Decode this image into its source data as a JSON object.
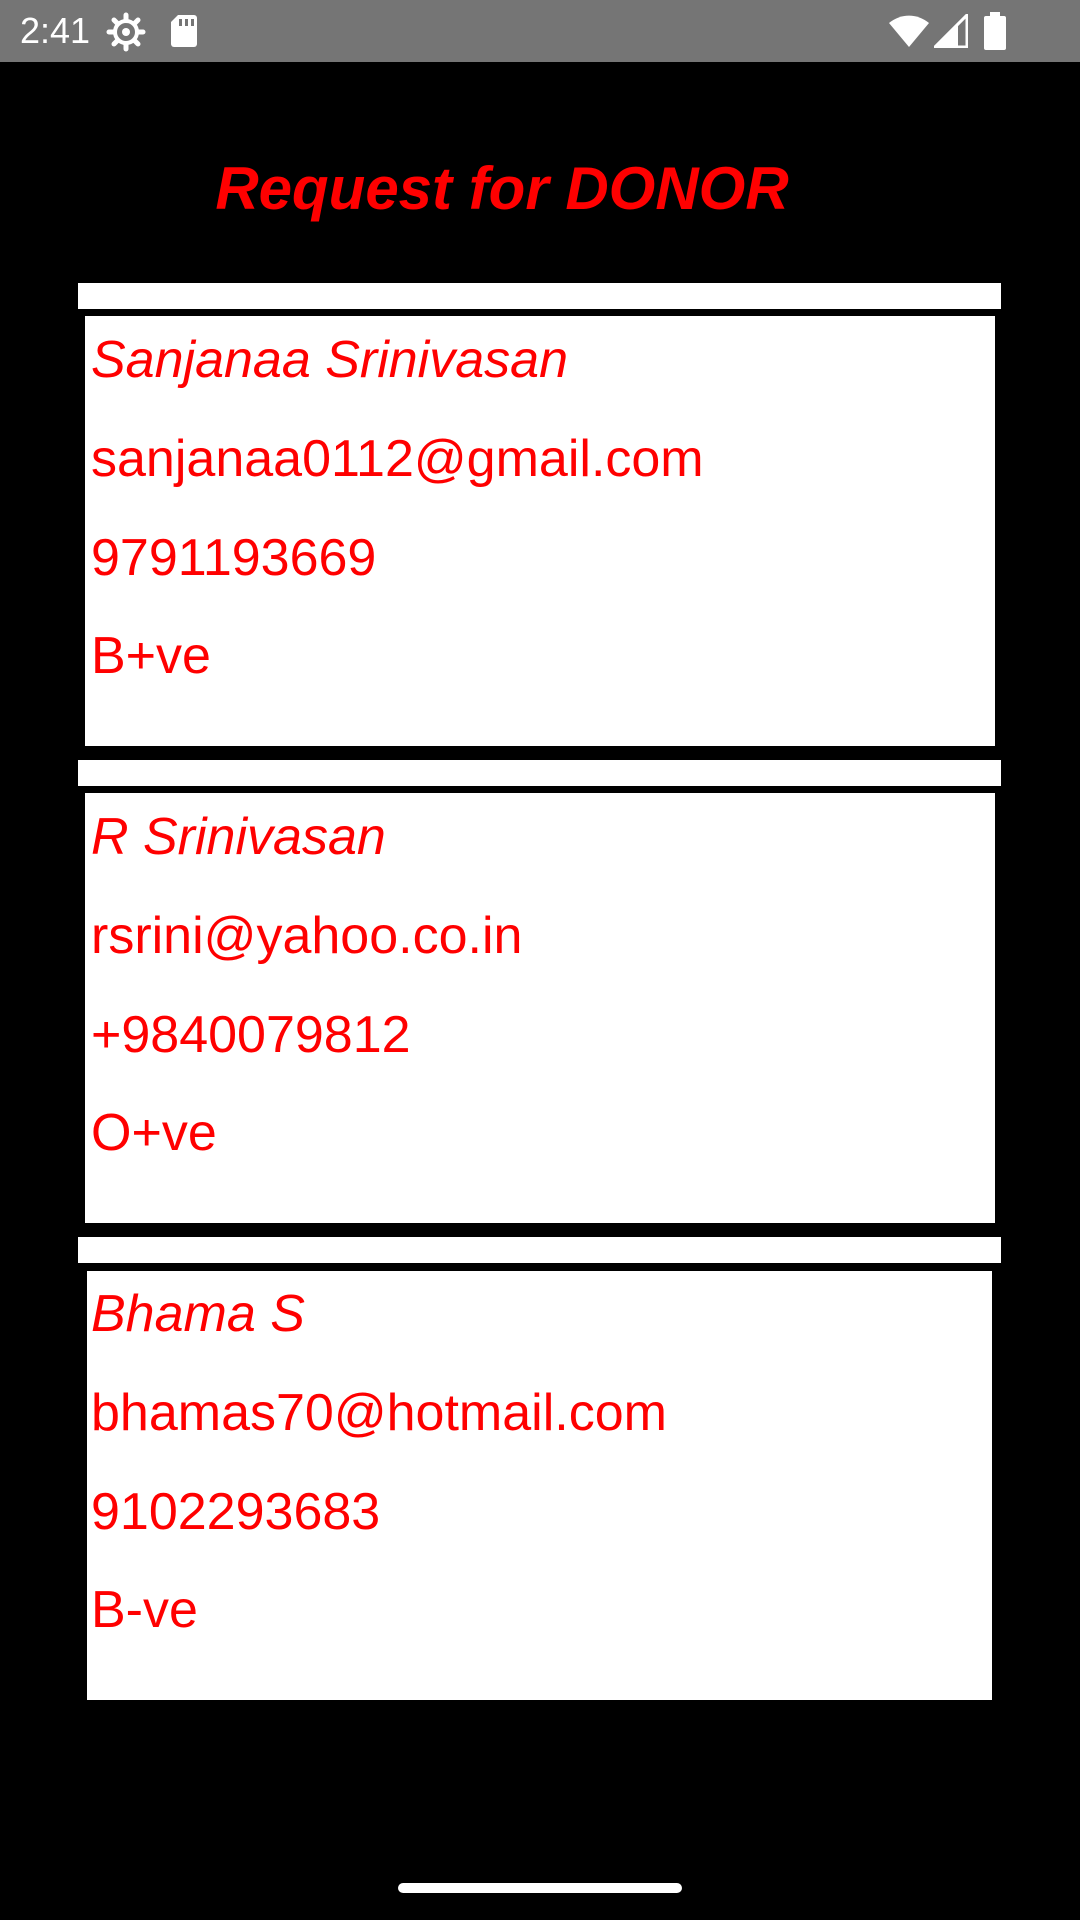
{
  "status_bar": {
    "time": "2:41",
    "left_icons": [
      "gear-icon",
      "sd-card-icon"
    ],
    "right_icons": [
      "wifi-icon",
      "signal-icon",
      "battery-icon"
    ]
  },
  "title": "Request for DONOR",
  "colors": {
    "background": "#000000",
    "accent_text": "#ff0000",
    "card": "#ffffff",
    "status_bar": "#757575"
  },
  "donors": [
    {
      "name": "Sanjanaa Srinivasan",
      "email": "sanjanaa0112@gmail.com",
      "phone": "9791193669",
      "blood_group": "B+ve"
    },
    {
      "name": "R Srinivasan",
      "email": "rsrini@yahoo.co.in",
      "phone": "+9840079812",
      "blood_group": "O+ve"
    },
    {
      "name": "Bhama S",
      "email": "bhamas70@hotmail.com",
      "phone": "9102293683",
      "blood_group": "B-ve"
    }
  ]
}
